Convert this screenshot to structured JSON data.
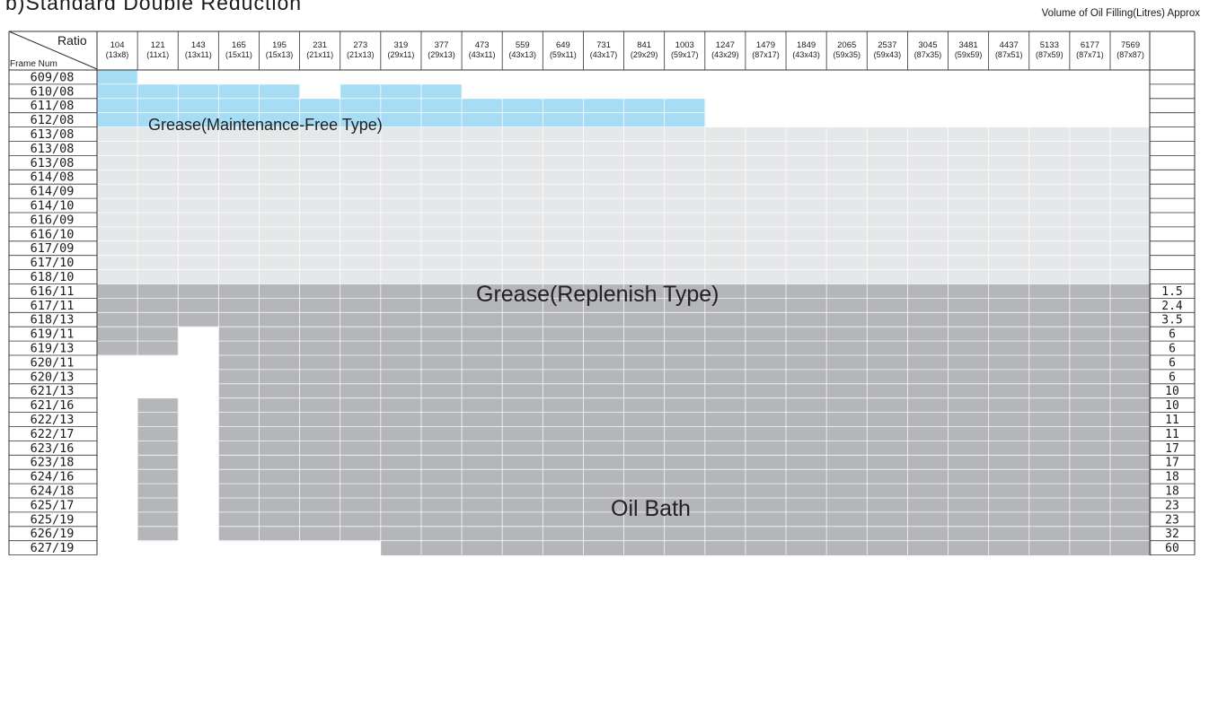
{
  "title": "b)Standard Double Reduction",
  "volume_title": "Volume of Oil Filling(Litres) Approx",
  "header": {
    "ratio_label": "Ratio",
    "frame_label": "Frame Num"
  },
  "ratios": [
    {
      "value": "104",
      "sub": "(13x8)"
    },
    {
      "value": "121",
      "sub": "(11x1)"
    },
    {
      "value": "143",
      "sub": "(13x11)"
    },
    {
      "value": "165",
      "sub": "(15x11)"
    },
    {
      "value": "195",
      "sub": "(15x13)"
    },
    {
      "value": "231",
      "sub": "(21x11)"
    },
    {
      "value": "273",
      "sub": "(21x13)"
    },
    {
      "value": "319",
      "sub": "(29x11)"
    },
    {
      "value": "377",
      "sub": "(29x13)"
    },
    {
      "value": "473",
      "sub": "(43x11)"
    },
    {
      "value": "559",
      "sub": "(43x13)"
    },
    {
      "value": "649",
      "sub": "(59x11)"
    },
    {
      "value": "731",
      "sub": "(43x17)"
    },
    {
      "value": "841",
      "sub": "(29x29)"
    },
    {
      "value": "1003",
      "sub": "(59x17)"
    },
    {
      "value": "1247",
      "sub": "(43x29)"
    },
    {
      "value": "1479",
      "sub": "(87x17)"
    },
    {
      "value": "1849",
      "sub": "(43x43)"
    },
    {
      "value": "2065",
      "sub": "(59x35)"
    },
    {
      "value": "2537",
      "sub": "(59x43)"
    },
    {
      "value": "3045",
      "sub": "(87x35)"
    },
    {
      "value": "3481",
      "sub": "(59x59)"
    },
    {
      "value": "4437",
      "sub": "(87x51)"
    },
    {
      "value": "5133",
      "sub": "(87x59)"
    },
    {
      "value": "6177",
      "sub": "(87x71)"
    },
    {
      "value": "7569",
      "sub": "(87x87)"
    }
  ],
  "rows": [
    {
      "frame": "609/08",
      "volume": "",
      "zone": "grease-mf",
      "first_col": 0,
      "last_col": 0,
      "gaps": []
    },
    {
      "frame": "610/08",
      "volume": "",
      "zone": "grease-mf",
      "first_col": 0,
      "last_col": 8,
      "gaps": [
        5
      ]
    },
    {
      "frame": "611/08",
      "volume": "",
      "zone": "grease-mf",
      "first_col": 0,
      "last_col": 14,
      "gaps": []
    },
    {
      "frame": "612/08",
      "volume": "",
      "zone": "grease-mf",
      "first_col": 0,
      "last_col": 14,
      "gaps": []
    },
    {
      "frame": "613/08",
      "volume": "",
      "zone": "grease-rep",
      "first_col": 0,
      "last_col": 25,
      "gaps": []
    },
    {
      "frame": "613/08",
      "volume": "",
      "zone": "grease-rep",
      "first_col": 0,
      "last_col": 25,
      "gaps": []
    },
    {
      "frame": "613/08",
      "volume": "",
      "zone": "grease-rep",
      "first_col": 0,
      "last_col": 25,
      "gaps": []
    },
    {
      "frame": "614/08",
      "volume": "",
      "zone": "grease-rep",
      "first_col": 0,
      "last_col": 25,
      "gaps": []
    },
    {
      "frame": "614/09",
      "volume": "",
      "zone": "grease-rep",
      "first_col": 0,
      "last_col": 25,
      "gaps": []
    },
    {
      "frame": "614/10",
      "volume": "",
      "zone": "grease-rep",
      "first_col": 0,
      "last_col": 25,
      "gaps": []
    },
    {
      "frame": "616/09",
      "volume": "",
      "zone": "grease-rep",
      "first_col": 0,
      "last_col": 25,
      "gaps": []
    },
    {
      "frame": "616/10",
      "volume": "",
      "zone": "grease-rep",
      "first_col": 0,
      "last_col": 25,
      "gaps": []
    },
    {
      "frame": "617/09",
      "volume": "",
      "zone": "grease-rep",
      "first_col": 0,
      "last_col": 25,
      "gaps": []
    },
    {
      "frame": "617/10",
      "volume": "",
      "zone": "grease-rep",
      "first_col": 0,
      "last_col": 25,
      "gaps": []
    },
    {
      "frame": "618/10",
      "volume": "",
      "zone": "grease-rep",
      "first_col": 0,
      "last_col": 25,
      "gaps": []
    },
    {
      "frame": "616/11",
      "volume": "1.5",
      "zone": "oil",
      "first_col": 0,
      "last_col": 25,
      "gaps": []
    },
    {
      "frame": "617/11",
      "volume": "2.4",
      "zone": "oil",
      "first_col": 0,
      "last_col": 25,
      "gaps": []
    },
    {
      "frame": "618/13",
      "volume": "3.5",
      "zone": "oil",
      "first_col": 0,
      "last_col": 25,
      "gaps": []
    },
    {
      "frame": "619/11",
      "volume": "6",
      "zone": "oil",
      "first_col": 0,
      "last_col": 25,
      "gaps": [
        2
      ]
    },
    {
      "frame": "619/13",
      "volume": "6",
      "zone": "oil",
      "first_col": 0,
      "last_col": 25,
      "gaps": [
        2
      ]
    },
    {
      "frame": "620/11",
      "volume": "6",
      "zone": "oil",
      "first_col": 3,
      "last_col": 25,
      "gaps": []
    },
    {
      "frame": "620/13",
      "volume": "6",
      "zone": "oil",
      "first_col": 3,
      "last_col": 25,
      "gaps": []
    },
    {
      "frame": "621/13",
      "volume": "10",
      "zone": "oil",
      "first_col": 3,
      "last_col": 25,
      "gaps": []
    },
    {
      "frame": "621/16",
      "volume": "10",
      "zone": "oil",
      "first_col": 1,
      "last_col": 25,
      "gaps": [
        2
      ]
    },
    {
      "frame": "622/13",
      "volume": "11",
      "zone": "oil",
      "first_col": 1,
      "last_col": 25,
      "gaps": [
        2
      ]
    },
    {
      "frame": "622/17",
      "volume": "11",
      "zone": "oil",
      "first_col": 1,
      "last_col": 25,
      "gaps": [
        2
      ]
    },
    {
      "frame": "623/16",
      "volume": "17",
      "zone": "oil",
      "first_col": 1,
      "last_col": 25,
      "gaps": [
        2
      ]
    },
    {
      "frame": "623/18",
      "volume": "17",
      "zone": "oil",
      "first_col": 1,
      "last_col": 25,
      "gaps": [
        2
      ]
    },
    {
      "frame": "624/16",
      "volume": "18",
      "zone": "oil",
      "first_col": 1,
      "last_col": 25,
      "gaps": [
        2
      ]
    },
    {
      "frame": "624/18",
      "volume": "18",
      "zone": "oil",
      "first_col": 1,
      "last_col": 25,
      "gaps": [
        2
      ]
    },
    {
      "frame": "625/17",
      "volume": "23",
      "zone": "oil",
      "first_col": 1,
      "last_col": 25,
      "gaps": [
        2
      ]
    },
    {
      "frame": "625/19",
      "volume": "23",
      "zone": "oil",
      "first_col": 1,
      "last_col": 25,
      "gaps": [
        2
      ]
    },
    {
      "frame": "626/19",
      "volume": "32",
      "zone": "oil",
      "first_col": 1,
      "last_col": 25,
      "gaps": [
        2
      ]
    },
    {
      "frame": "627/19",
      "volume": "60",
      "zone": "oil",
      "first_col": 7,
      "last_col": 25,
      "gaps": []
    }
  ],
  "zones": {
    "grease_mf_label": "Grease(Maintenance-Free Type)",
    "grease_rep_label": "Grease(Replenish Type)",
    "oil_bath_label": "Oil Bath"
  },
  "colors": {
    "grease_mf": "#a6dcf4",
    "grease_rep": "#e6e7e9",
    "oil_bath": "#b5b6b9",
    "grid_line": "#ffffff",
    "border": "#333333"
  }
}
